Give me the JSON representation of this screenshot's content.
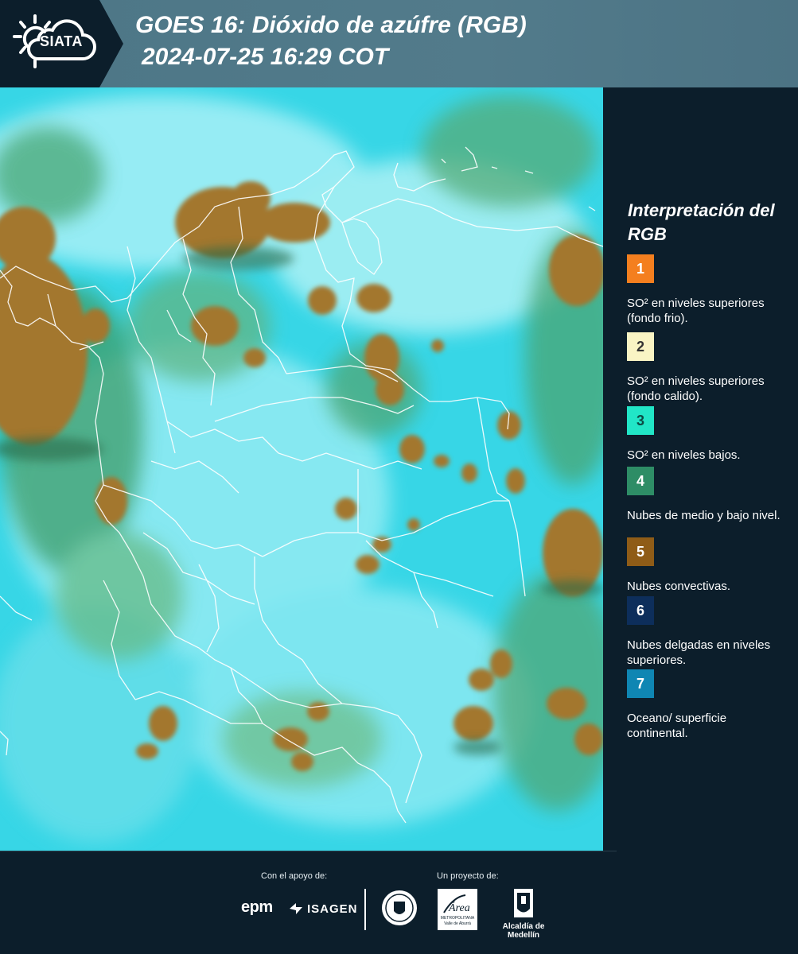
{
  "header": {
    "brand": "SIATA",
    "title": "GOES 16: Dióxido de azúfre (RGB)",
    "datetime": "2024-07-25 16:29 COT"
  },
  "legend": {
    "title": "Interpretación del RGB",
    "items": [
      {
        "number": "1",
        "color": "#f47f1f",
        "label": "SO² en niveles superiores (fondo frio)."
      },
      {
        "number": "2",
        "color": "#f9f4c4",
        "label": "SO² en niveles superiores (fondo calido)."
      },
      {
        "number": "3",
        "color": "#21e6c7",
        "label": "SO² en niveles bajos."
      },
      {
        "number": "4",
        "color": "#2e8d66",
        "label": "Nubes de medio y bajo nivel."
      },
      {
        "number": "5",
        "color": "#8f5c17",
        "label": "Nubes convectivas."
      },
      {
        "number": "6",
        "color": "#0d2e5b",
        "label": "Nubes delgadas en niveles superiores."
      },
      {
        "number": "7",
        "color": "#0f86b3",
        "label": "Oceano/ superficie continental."
      }
    ]
  },
  "footer": {
    "support_label": "Con el apoyo de:",
    "project_label": "Un proyecto de:",
    "sponsors": [
      "epm",
      "ISAGEN"
    ],
    "partners": {
      "area_top": "Área",
      "area_line1": "METROPOLITANA",
      "area_line2": "Valle de Aburrá",
      "alcaldia": "Alcaldía de Medellín"
    }
  },
  "colors": {
    "background": "#0c1e2b",
    "header_band": "#527b8b",
    "map_cyan": "#35d4e6",
    "cloud_brown": "#a0772e",
    "cloud_green": "#3b9a6b",
    "border_white": "#ffffff"
  }
}
